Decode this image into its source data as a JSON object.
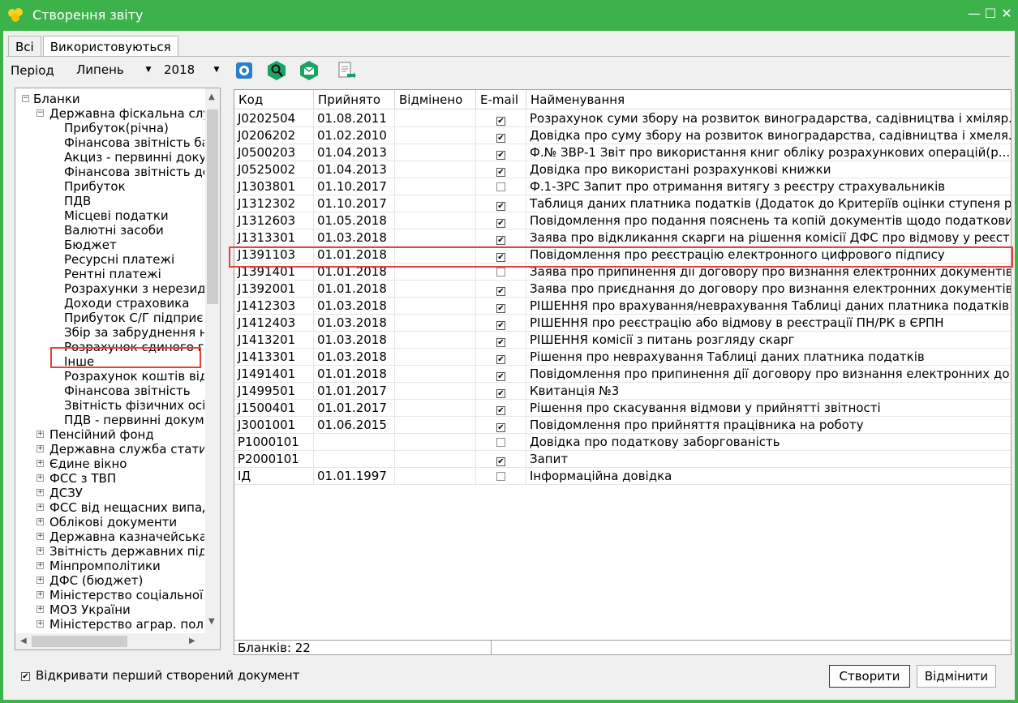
{
  "window": {
    "title": "Створення звіту",
    "controls": [
      "—",
      "☐",
      "✕"
    ]
  },
  "tabs": [
    "Всі",
    "Використовуються"
  ],
  "toolbar": {
    "period_label": "Період",
    "month": "Липень",
    "year": "2018"
  },
  "tree": {
    "root": "Бланки",
    "group": "Державна фіскальна слу",
    "children": [
      "Прибуток(річна)",
      "Фінансова звітність ба",
      "Акциз - первинні доку",
      "Фінансова звітність де",
      "Прибуток",
      "ПДВ",
      "Місцеві податки",
      "Валютні засоби",
      "Бюджет",
      "Ресурсні платежі",
      "Рентні платежі",
      "Розрахунки з нерезид",
      "Доходи страховика",
      "Прибуток С/Г підприє",
      "Збір за забруднення н",
      "Розрахунок єдиного г",
      "Інше",
      "Розрахунок коштів від",
      "Фінансова звітність",
      "Звітність фізичних осіб",
      "ПДВ - первинні докум"
    ],
    "groups": [
      "Пенсійний фонд",
      "Державна служба стати",
      "Єдине вікно",
      "ФСС з ТВП",
      "ДСЗУ",
      "ФСС від нещасних випад",
      "Облікові документи",
      "Державна казначейська",
      "Звітність державних підп",
      "Мінпромполітики",
      "ДФС (бюджет)",
      "Міністерство соціальної п",
      "МОЗ України",
      "Міністерство аграр. полі"
    ]
  },
  "grid": {
    "columns": [
      "Код",
      "Прийнято",
      "Відмінено",
      "E-mail",
      "Найменування"
    ],
    "rows": [
      {
        "code": "J0202504",
        "accepted": "01.08.2011",
        "cancelled": "",
        "email": true,
        "name": " Розрахунок суми збору на розвиток виноградарства, садівництва і хміляр..."
      },
      {
        "code": "J0206202",
        "accepted": "01.02.2010",
        "cancelled": "",
        "email": true,
        "name": " Довідка про суму збору на розвиток виноградарства, садівництва і хмеля..."
      },
      {
        "code": "J0500203",
        "accepted": "01.04.2013",
        "cancelled": "",
        "email": true,
        "name": "Ф.№ ЗВР-1 Звіт про використання книг обліку розрахункових операцій(р..."
      },
      {
        "code": "J0525002",
        "accepted": "01.04.2013",
        "cancelled": "",
        "email": true,
        "name": "Довідка про використані розрахункові книжки"
      },
      {
        "code": "J1303801",
        "accepted": "01.10.2017",
        "cancelled": "",
        "email": false,
        "name": "Ф.1-ЗРС Запит про отримання витягу з реєстру страхувальників"
      },
      {
        "code": "J1312302",
        "accepted": "01.10.2017",
        "cancelled": "",
        "email": true,
        "name": "Таблиця даних платника податків (Додаток до Критеріїв оцінки ступеня ри..."
      },
      {
        "code": "J1312603",
        "accepted": "01.05.2018",
        "cancelled": "",
        "email": true,
        "name": "Повідомлення про подання пояснень та копій документів щодо податкови..."
      },
      {
        "code": "J1313301",
        "accepted": "01.03.2018",
        "cancelled": "",
        "email": true,
        "name": "Заява про відкликання скарги на рішення комісії ДФС про відмову у реєст..."
      },
      {
        "code": "J1391103",
        "accepted": "01.01.2018",
        "cancelled": "",
        "email": true,
        "name": "Повідомлення про реєстрацію електронного цифрового підпису"
      },
      {
        "code": "J1391401",
        "accepted": "01.01.2018",
        "cancelled": "",
        "email": false,
        "name": "Заява про припинення дії договору про визнання електронних документів"
      },
      {
        "code": "J1392001",
        "accepted": "01.01.2018",
        "cancelled": "",
        "email": true,
        "name": "Заява про приєднання до договору про визнання електронних документів"
      },
      {
        "code": "J1412303",
        "accepted": "01.03.2018",
        "cancelled": "",
        "email": true,
        "name": "РІШЕННЯ про врахування/неврахування Таблиці даних платника податків"
      },
      {
        "code": "J1412403",
        "accepted": "01.03.2018",
        "cancelled": "",
        "email": true,
        "name": "РІШЕННЯ про реєстрацію або відмову в реєстрації ПН/РК в ЄРПН"
      },
      {
        "code": "J1413201",
        "accepted": "01.03.2018",
        "cancelled": "",
        "email": true,
        "name": "РІШЕННЯ комісії з питань розгляду скарг"
      },
      {
        "code": "J1413301",
        "accepted": "01.03.2018",
        "cancelled": "",
        "email": true,
        "name": "Рішення про неврахування Таблиці даних платника податків"
      },
      {
        "code": "J1491401",
        "accepted": "01.01.2018",
        "cancelled": "",
        "email": true,
        "name": "Повідомлення про припинення дії договору про визнання електронних до..."
      },
      {
        "code": "J1499501",
        "accepted": "01.01.2017",
        "cancelled": "",
        "email": true,
        "name": "Квитанція №3"
      },
      {
        "code": "J1500401",
        "accepted": "01.01.2017",
        "cancelled": "",
        "email": true,
        "name": "Рішення про скасування відмови у прийнятті звітності"
      },
      {
        "code": "J3001001",
        "accepted": "01.06.2015",
        "cancelled": "",
        "email": true,
        "name": "Повідомлення про прийняття працівника на роботу"
      },
      {
        "code": "P1000101",
        "accepted": "",
        "cancelled": "",
        "email": false,
        "name": "Довідка про податкову заборгованість"
      },
      {
        "code": "P2000101",
        "accepted": "",
        "cancelled": "",
        "email": true,
        "name": "Запит"
      },
      {
        "code": "ІД",
        "accepted": "01.01.1997",
        "cancelled": "",
        "email": false,
        "name": "Інформаційна довідка"
      }
    ],
    "status": "Бланків: 22"
  },
  "footer": {
    "open_first_label": "Відкривати перший створений документ",
    "open_first_checked": true,
    "create_label": "Створити",
    "cancel_label": "Відмінити"
  },
  "colors": {
    "frame": "#3cb34a",
    "highlight": "#e8403a",
    "toolbar_icon": "#1aa364"
  },
  "icons": [
    "app-flower-icon",
    "settings-gear-icon",
    "search-icon",
    "envelope-icon",
    "document-arrow-icon"
  ]
}
